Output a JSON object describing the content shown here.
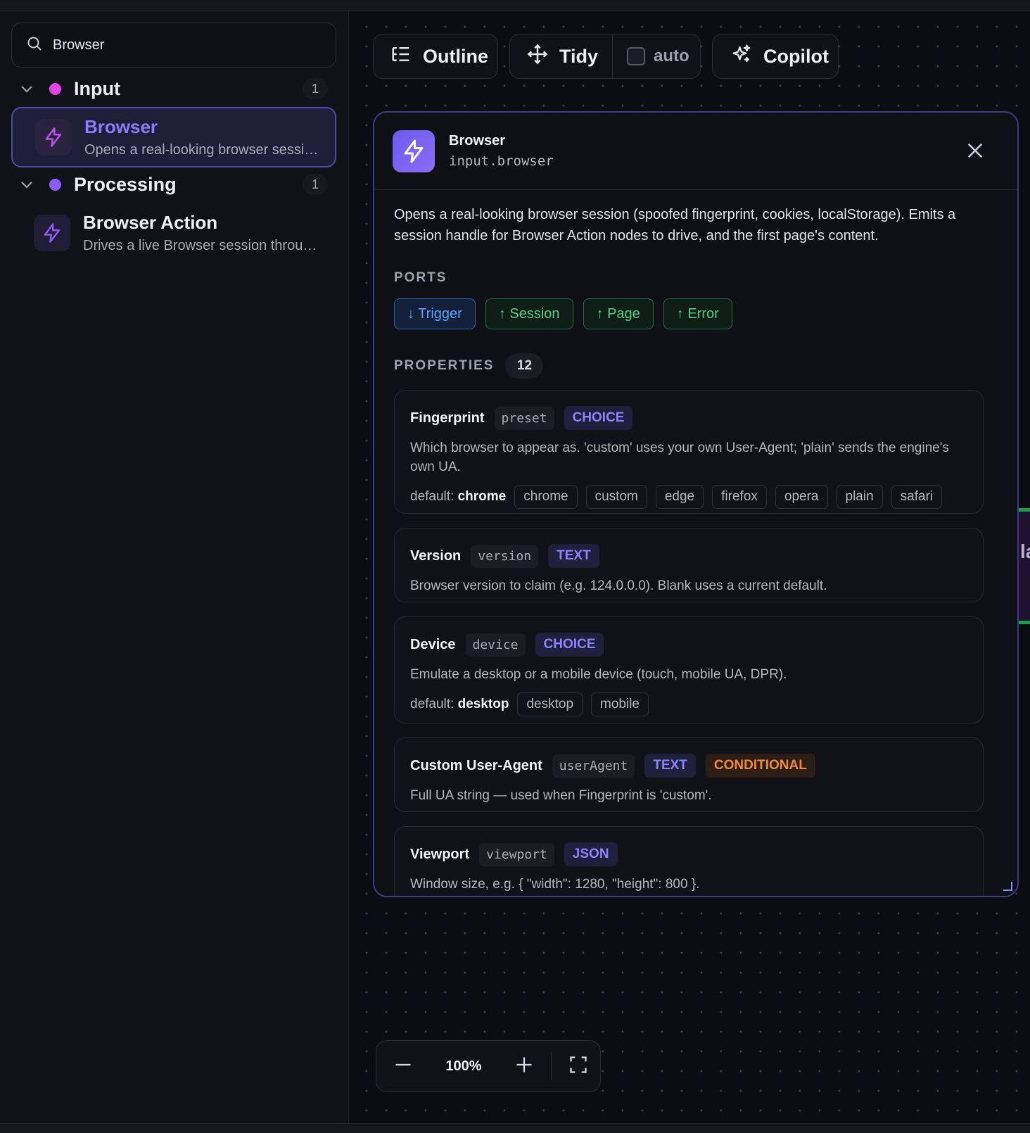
{
  "search": {
    "value": "Browser",
    "icon": "search-icon"
  },
  "groups": [
    {
      "title": "Input",
      "count": "1",
      "dot_color": "#e044e8",
      "items": [
        {
          "title": "Browser",
          "desc": "Opens a real-looking browser session (spoofed fingerprint, cookies, localStorage).",
          "icon": "lightning-icon",
          "selected": true
        }
      ]
    },
    {
      "title": "Processing",
      "count": "1",
      "dot_color": "#8b5cf6",
      "items": [
        {
          "title": "Browser Action",
          "desc": "Drives a live Browser session through actions.",
          "icon": "lightning-icon",
          "selected": false
        }
      ]
    }
  ],
  "toolbar": {
    "outline_label": "Outline",
    "tidy_label": "Tidy",
    "auto_label": "auto",
    "copilot_label": "Copilot"
  },
  "panel": {
    "title": "Browser",
    "id": "input.browser",
    "description": "Opens a real-looking browser session (spoofed fingerprint, cookies, localStorage). Emits a session handle for Browser Action nodes to drive, and the first page's content.",
    "ports_label": "PORTS",
    "ports": [
      {
        "label": "↓ Trigger",
        "direction": "in"
      },
      {
        "label": "↑ Session",
        "direction": "out"
      },
      {
        "label": "↑ Page",
        "direction": "out"
      },
      {
        "label": "↑ Error",
        "direction": "out"
      }
    ],
    "properties_label": "PROPERTIES",
    "properties_count": "12",
    "properties": [
      {
        "name": "Fingerprint",
        "key": "preset",
        "tag": "CHOICE",
        "desc": "Which browser to appear as. 'custom' uses your own User-Agent; 'plain' sends the engine's own UA.",
        "default_label": "default:",
        "default_value": "chrome",
        "options": [
          "chrome",
          "custom",
          "edge",
          "firefox",
          "opera",
          "plain",
          "safari"
        ]
      },
      {
        "name": "Version",
        "key": "version",
        "tag": "TEXT",
        "desc": "Browser version to claim (e.g. 124.0.0.0). Blank uses a current default."
      },
      {
        "name": "Device",
        "key": "device",
        "tag": "CHOICE",
        "desc": "Emulate a desktop or a mobile device (touch, mobile UA, DPR).",
        "default_label": "default:",
        "default_value": "desktop",
        "options": [
          "desktop",
          "mobile"
        ]
      },
      {
        "name": "Custom User-Agent",
        "key": "userAgent",
        "tag": "TEXT",
        "tag2": "CONDITIONAL",
        "desc": "Full UA string — used when Fingerprint is 'custom'."
      },
      {
        "name": "Viewport",
        "key": "viewport",
        "tag": "JSON",
        "desc": "Window size, e.g. { \"width\": 1280, \"height\": 800 }."
      }
    ]
  },
  "peek_text": "la",
  "zoom": {
    "level": "100%"
  }
}
